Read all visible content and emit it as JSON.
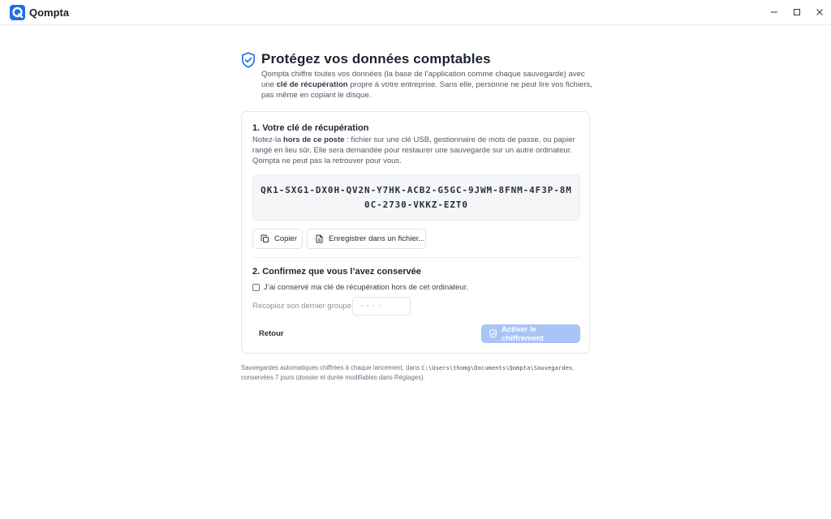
{
  "app": {
    "name": "Qompta",
    "logo_icon": "qompta-logo-icon",
    "accent": "#1d6fe6"
  },
  "window_controls": {
    "minimize_icon": "minimize-icon",
    "maximize_icon": "maximize-icon",
    "close_icon": "close-icon"
  },
  "header": {
    "icon": "shield-check-icon",
    "title": "Protégez vos données comptables",
    "intro_part1": "Qompta chiffre toutes vos données (la base de l’application comme chaque sauvegarde) avec une ",
    "intro_bold": "clé de récupération",
    "intro_part2": " propre à votre entreprise. Sans elle, personne ne peut lire vos fichiers, pas même en copiant le disque."
  },
  "step1": {
    "title": "1. Votre clé de récupération",
    "text_part1": "Notez-la ",
    "text_bold": "hors de ce poste",
    "text_part2": " : fichier sur une clé USB, gestionnaire de mots de passe, ou papier rangé en lieu sûr. Elle sera demandée pour restaurer une sauvegarde sur un autre ordinateur. Qompta ne peut pas la retrouver pour vous.",
    "recovery_key": "QK1-SXG1-DX0H-QV2N-Y7HK-ACB2-G5GC-9JWM-8FNM-4F3P-8M0C-2730-VKKZ-EZT0",
    "copy_label": "Copier",
    "copy_icon": "copy-icon",
    "save_label": "Enregistrer dans un fichier...",
    "save_icon": "file-save-icon"
  },
  "step2": {
    "title": "2. Confirmez que vous l’avez conservée",
    "checkbox_label": "J’ai conservé ma clé de récupération hors de cet ordinateur.",
    "checkbox_checked": false,
    "group_label": "Recopiez son dernier groupe :",
    "group_placeholder": "····"
  },
  "actions": {
    "back_label": "Retour",
    "activate_label": "Activer le chiffrement",
    "activate_icon": "shield-check-icon",
    "activate_color": "#a9c4f5"
  },
  "footnote": {
    "part1": "Sauvegardes automatiques chiffrées à chaque lancement, dans ",
    "path": "C:\\Users\\thomg\\Documents\\Qompta\\Sauvegardes",
    "part2": ", conservées 7 jours (dossier et durée modifiables dans Réglages)."
  }
}
